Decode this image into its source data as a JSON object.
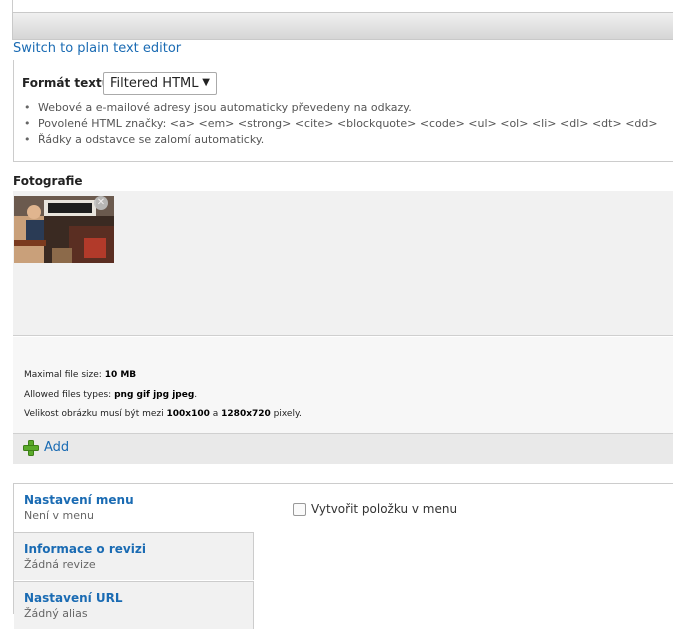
{
  "editor": {
    "switch_link": "Switch to plain text editor"
  },
  "text_format": {
    "label": "Formát textu",
    "selected": "Filtered HTML",
    "tips": [
      "Webové a e-mailové adresy jsou automaticky převedeny na odkazy.",
      "Povolené HTML značky: <a> <em> <strong> <cite> <blockquote> <code> <ul> <ol> <li> <dl> <dt> <dd>",
      "Řádky a odstavce se zalomí automaticky."
    ]
  },
  "photos": {
    "title": "Fotografie",
    "info": {
      "max_size_label": "Maximal file size:",
      "max_size_value": "10 MB",
      "allowed_label": "Allowed files types:",
      "allowed_value": "png gif jpg jpeg",
      "dims_prefix": "Velikost obrázku musí být mezi",
      "dims_min": "100x100",
      "dims_and": "a",
      "dims_max": "1280x720",
      "dims_suffix": "pixely."
    },
    "add_label": "Add"
  },
  "vertical_tabs": [
    {
      "title": "Nastavení menu",
      "summary": "Není v menu"
    },
    {
      "title": "Informace o revizi",
      "summary": "Žádná revize"
    },
    {
      "title": "Nastavení URL",
      "summary": "Žádný alias"
    }
  ],
  "menu_settings": {
    "checkbox_label": "Vytvořit položku v menu",
    "checked": false
  },
  "icons": {
    "remove": "close-icon",
    "add": "plus-icon",
    "select_arrow": "chevron-down-icon"
  }
}
